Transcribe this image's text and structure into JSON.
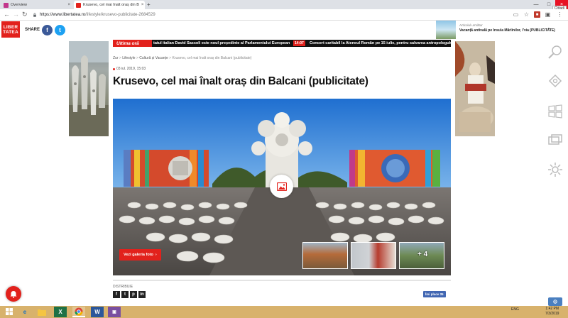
{
  "browser": {
    "tabs": [
      {
        "label": "Overview",
        "active": false
      },
      {
        "label": "Krusevo, cel mai înalt oraș din B",
        "active": true
      }
    ],
    "new_tab_symbol": "+",
    "url_host": "https://www.libertatea.ro",
    "url_path": "/lifestyle/krusevo-publicitate-2684529",
    "guest_label": "Cittadi"
  },
  "header": {
    "logo_line1": "LIBER",
    "logo_line2": "TATEA",
    "share_label": "SHARE",
    "facebook_letter": "f",
    "twitter_letter": "t",
    "promo_kicker": "Articolul următor",
    "promo_title": "Vacanță antivală pe Insula Mărlinilor, l'via (PUBLICITATE)",
    "promo_arrow": "›"
  },
  "ticker": {
    "label": "Ultima oră",
    "items": [
      {
        "time": "",
        "text": "tatul italian David Sassoli este noul președinte al Parlamentului European"
      },
      {
        "time": "14:07",
        "text": "Concert caritabil la Ateneul Român pe 15 iulie, pentru salvarea antropologului Vla"
      }
    ]
  },
  "article": {
    "breadcrumb": [
      "Zur",
      "Lifestyle",
      "Cultură și Vacanțe",
      "Krusevo, cel mai înalt oraș din Balcani (publicitate)"
    ],
    "date": "03 iul. 2019, 15:03",
    "title": "Krusevo, cel mai înalt oraș din Balcani (publicitate)",
    "gallery_button": "Vezi galeria foto",
    "gallery_more": "+ 4",
    "distribuie_label": "DISTRIBUIE",
    "social_letters": [
      "f",
      "t",
      "p",
      "in"
    ],
    "fb_like_label": "Îmi place 35"
  },
  "taskbar": {
    "language": "ENG",
    "time": "1:42 PM",
    "date": "7/3/2019"
  },
  "colors": {
    "brand_red": "#e2211c",
    "facebook": "#3b5998",
    "twitter": "#1da1f2",
    "taskbar": "#d8b26c"
  },
  "icons": [
    "search-icon",
    "star-icon",
    "menu-icon",
    "photo-icon",
    "bell-icon",
    "settings-icon",
    "windows-icon"
  ]
}
